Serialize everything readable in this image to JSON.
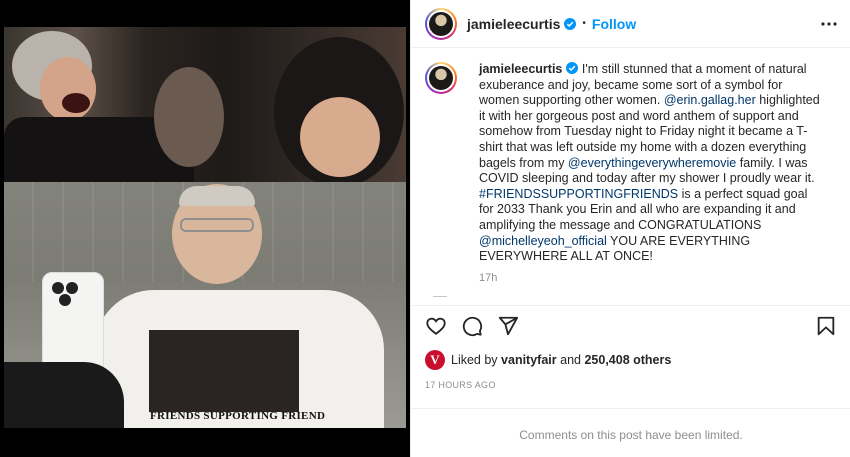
{
  "post": {
    "username": "jamieleecurtis",
    "follow_label": "Follow",
    "separator": "•",
    "shirt_text": "FRIENDS SUPPORTING FRIEND",
    "caption": {
      "username": "jamieleecurtis",
      "part1": " I'm still stunned that a moment of natural exuberance and joy, became some sort of a symbol for women supporting other women. ",
      "mention1": "@erin.gallag.her",
      "part2": " highlighted it with her gorgeous post and word anthem of support and somehow from Tuesday night to Friday night it became a T-shirt that was left outside my home with a dozen everything bagels from my ",
      "mention2": "@everythingeverywheremovie",
      "part3": " family. I was COVID sleeping and today after my shower I proudly wear it. ",
      "hashtag": "#FRIENDSSUPPORTINGFRIENDS",
      "part4": " is a perfect squad goal for 2033 Thank you Erin and all who are expanding it and amplifying the message and CONGRATULATIONS ",
      "mention3": "@michelleyeoh_official",
      "part5": " YOU ARE EVERYTHING EVERYWHERE ALL AT ONCE!",
      "time": "17h"
    },
    "likes": {
      "prefix": "Liked by ",
      "user": "vanityfair",
      "middle": " and ",
      "count": "250,408 others",
      "logo_letter": "V"
    },
    "age": "17 HOURS AGO",
    "comments_limited": "Comments on this post have been limited."
  },
  "icons": [
    "verified-badge-icon",
    "more-options-icon",
    "heart-icon",
    "comment-icon",
    "share-icon",
    "bookmark-icon"
  ],
  "colors": {
    "link": "#00376b",
    "follow": "#0095f6",
    "muted": "#8e8e8e",
    "verified": "#0095f6"
  }
}
